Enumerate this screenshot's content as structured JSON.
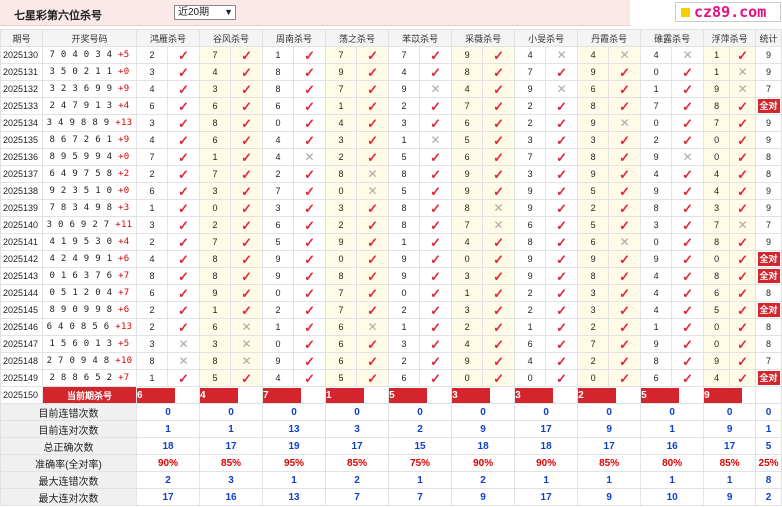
{
  "header": {
    "title": "七星彩第六位杀号",
    "select_value": "近20期"
  },
  "logo": {
    "text": "cz89.com"
  },
  "columns": [
    "期号",
    "开奖号码",
    "鸿雁杀号",
    "谷风杀号",
    "周南杀号",
    "荡之杀号",
    "苯苡杀号",
    "采薇杀号",
    "小旻杀号",
    "丹霞杀号",
    "碓露杀号",
    "浮萍杀号",
    "统计"
  ],
  "rows": [
    {
      "period": "2025130",
      "draw": "704034",
      "add": "+5",
      "kills": [
        [
          2,
          1
        ],
        [
          7,
          1
        ],
        [
          1,
          1
        ],
        [
          7,
          1
        ],
        [
          7,
          1
        ],
        [
          9,
          1
        ],
        [
          4,
          0
        ],
        [
          4,
          0
        ],
        [
          4,
          0
        ],
        [
          1,
          1
        ]
      ],
      "stat": "9"
    },
    {
      "period": "2025131",
      "draw": "350211",
      "add": "+0",
      "kills": [
        [
          3,
          1
        ],
        [
          4,
          1
        ],
        [
          8,
          1
        ],
        [
          9,
          1
        ],
        [
          4,
          1
        ],
        [
          8,
          1
        ],
        [
          7,
          1
        ],
        [
          9,
          1
        ],
        [
          0,
          1
        ],
        [
          1,
          0
        ]
      ],
      "stat": "9"
    },
    {
      "period": "2025132",
      "draw": "323699",
      "add": "+9",
      "kills": [
        [
          4,
          1
        ],
        [
          3,
          1
        ],
        [
          8,
          1
        ],
        [
          7,
          1
        ],
        [
          9,
          0
        ],
        [
          4,
          1
        ],
        [
          9,
          0
        ],
        [
          6,
          1
        ],
        [
          1,
          1
        ],
        [
          9,
          0
        ]
      ],
      "stat": "7"
    },
    {
      "period": "2025133",
      "draw": "247913",
      "add": "+4",
      "kills": [
        [
          6,
          1
        ],
        [
          6,
          1
        ],
        [
          6,
          1
        ],
        [
          1,
          1
        ],
        [
          2,
          1
        ],
        [
          7,
          1
        ],
        [
          2,
          1
        ],
        [
          8,
          1
        ],
        [
          7,
          1
        ],
        [
          8,
          1
        ]
      ],
      "stat": "all"
    },
    {
      "period": "2025134",
      "draw": "349889",
      "add": "+13",
      "kills": [
        [
          3,
          1
        ],
        [
          8,
          1
        ],
        [
          0,
          1
        ],
        [
          4,
          1
        ],
        [
          3,
          1
        ],
        [
          6,
          1
        ],
        [
          2,
          1
        ],
        [
          9,
          0
        ],
        [
          0,
          1
        ],
        [
          7,
          1
        ]
      ],
      "stat": "9"
    },
    {
      "period": "2025135",
      "draw": "867261",
      "add": "+9",
      "kills": [
        [
          4,
          1
        ],
        [
          6,
          1
        ],
        [
          4,
          1
        ],
        [
          3,
          1
        ],
        [
          1,
          0
        ],
        [
          5,
          1
        ],
        [
          3,
          1
        ],
        [
          3,
          1
        ],
        [
          2,
          1
        ],
        [
          0,
          1
        ]
      ],
      "stat": "9"
    },
    {
      "period": "2025136",
      "draw": "895994",
      "add": "+0",
      "kills": [
        [
          7,
          1
        ],
        [
          1,
          1
        ],
        [
          4,
          0
        ],
        [
          2,
          1
        ],
        [
          5,
          1
        ],
        [
          6,
          1
        ],
        [
          7,
          1
        ],
        [
          8,
          1
        ],
        [
          9,
          0
        ],
        [
          0,
          1
        ]
      ],
      "stat": "8"
    },
    {
      "period": "2025137",
      "draw": "649758",
      "add": "+2",
      "kills": [
        [
          2,
          1
        ],
        [
          7,
          1
        ],
        [
          2,
          1
        ],
        [
          8,
          0
        ],
        [
          8,
          1
        ],
        [
          9,
          1
        ],
        [
          3,
          1
        ],
        [
          9,
          1
        ],
        [
          4,
          1
        ],
        [
          4,
          1
        ]
      ],
      "stat": "8"
    },
    {
      "period": "2025138",
      "draw": "923510",
      "add": "+0",
      "kills": [
        [
          6,
          1
        ],
        [
          3,
          1
        ],
        [
          7,
          1
        ],
        [
          0,
          0
        ],
        [
          5,
          1
        ],
        [
          9,
          1
        ],
        [
          9,
          1
        ],
        [
          5,
          1
        ],
        [
          9,
          1
        ],
        [
          4,
          1
        ]
      ],
      "stat": "9"
    },
    {
      "period": "2025139",
      "draw": "783498",
      "add": "+3",
      "kills": [
        [
          1,
          1
        ],
        [
          0,
          1
        ],
        [
          3,
          1
        ],
        [
          3,
          1
        ],
        [
          8,
          1
        ],
        [
          8,
          0
        ],
        [
          9,
          1
        ],
        [
          2,
          1
        ],
        [
          8,
          1
        ],
        [
          3,
          1
        ]
      ],
      "stat": "9"
    },
    {
      "period": "2025140",
      "draw": "306927",
      "add": "+11",
      "kills": [
        [
          3,
          1
        ],
        [
          2,
          1
        ],
        [
          6,
          1
        ],
        [
          2,
          1
        ],
        [
          8,
          1
        ],
        [
          7,
          0
        ],
        [
          6,
          1
        ],
        [
          5,
          1
        ],
        [
          3,
          1
        ],
        [
          7,
          0
        ]
      ],
      "stat": "7"
    },
    {
      "period": "2025141",
      "draw": "419530",
      "add": "+4",
      "kills": [
        [
          2,
          1
        ],
        [
          7,
          1
        ],
        [
          5,
          1
        ],
        [
          9,
          1
        ],
        [
          1,
          1
        ],
        [
          4,
          1
        ],
        [
          8,
          1
        ],
        [
          6,
          0
        ],
        [
          0,
          1
        ],
        [
          8,
          1
        ]
      ],
      "stat": "9"
    },
    {
      "period": "2025142",
      "draw": "424991",
      "add": "+6",
      "kills": [
        [
          4,
          1
        ],
        [
          8,
          1
        ],
        [
          9,
          1
        ],
        [
          0,
          1
        ],
        [
          9,
          1
        ],
        [
          0,
          1
        ],
        [
          9,
          1
        ],
        [
          9,
          1
        ],
        [
          9,
          1
        ],
        [
          0,
          1
        ]
      ],
      "stat": "all"
    },
    {
      "period": "2025143",
      "draw": "016376",
      "add": "+7",
      "kills": [
        [
          8,
          1
        ],
        [
          8,
          1
        ],
        [
          9,
          1
        ],
        [
          8,
          1
        ],
        [
          9,
          1
        ],
        [
          3,
          1
        ],
        [
          9,
          1
        ],
        [
          8,
          1
        ],
        [
          4,
          1
        ],
        [
          8,
          1
        ]
      ],
      "stat": "all"
    },
    {
      "period": "2025144",
      "draw": "051204",
      "add": "+7",
      "kills": [
        [
          6,
          1
        ],
        [
          9,
          1
        ],
        [
          0,
          1
        ],
        [
          7,
          1
        ],
        [
          0,
          1
        ],
        [
          1,
          1
        ],
        [
          2,
          1
        ],
        [
          3,
          1
        ],
        [
          4,
          1
        ],
        [
          6,
          1
        ]
      ],
      "stat": "8"
    },
    {
      "period": "2025145",
      "draw": "890998",
      "add": "+6",
      "kills": [
        [
          2,
          1
        ],
        [
          1,
          1
        ],
        [
          2,
          1
        ],
        [
          7,
          1
        ],
        [
          2,
          1
        ],
        [
          3,
          1
        ],
        [
          2,
          1
        ],
        [
          3,
          1
        ],
        [
          4,
          1
        ],
        [
          5,
          1
        ]
      ],
      "stat": "all"
    },
    {
      "period": "2025146",
      "draw": "640856",
      "add": "+13",
      "kills": [
        [
          2,
          1
        ],
        [
          6,
          0
        ],
        [
          1,
          1
        ],
        [
          6,
          0
        ],
        [
          1,
          1
        ],
        [
          2,
          1
        ],
        [
          1,
          1
        ],
        [
          2,
          1
        ],
        [
          1,
          1
        ],
        [
          0,
          1
        ]
      ],
      "stat": "8"
    },
    {
      "period": "2025147",
      "draw": "156013",
      "add": "+5",
      "kills": [
        [
          3,
          0
        ],
        [
          3,
          0
        ],
        [
          0,
          1
        ],
        [
          6,
          1
        ],
        [
          3,
          1
        ],
        [
          4,
          1
        ],
        [
          6,
          1
        ],
        [
          7,
          1
        ],
        [
          9,
          1
        ],
        [
          0,
          1
        ]
      ],
      "stat": "8"
    },
    {
      "period": "2025148",
      "draw": "270948",
      "add": "+10",
      "kills": [
        [
          8,
          0
        ],
        [
          8,
          0
        ],
        [
          9,
          1
        ],
        [
          6,
          1
        ],
        [
          2,
          1
        ],
        [
          9,
          1
        ],
        [
          4,
          1
        ],
        [
          2,
          1
        ],
        [
          8,
          1
        ],
        [
          9,
          1
        ]
      ],
      "stat": "7"
    },
    {
      "period": "2025149",
      "draw": "288652",
      "add": "+7",
      "kills": [
        [
          1,
          1
        ],
        [
          5,
          1
        ],
        [
          4,
          1
        ],
        [
          5,
          1
        ],
        [
          6,
          1
        ],
        [
          0,
          1
        ],
        [
          0,
          1
        ],
        [
          0,
          1
        ],
        [
          6,
          1
        ],
        [
          4,
          1
        ]
      ],
      "stat": "all"
    }
  ],
  "current": {
    "period": "2025150",
    "label": "当前期杀号",
    "kills": [
      "6",
      "4",
      "7",
      "1",
      "5",
      "3",
      "3",
      "2",
      "5",
      "9"
    ]
  },
  "all_text": "全对",
  "stats": [
    {
      "name": "目前连错次数",
      "values": [
        "0",
        "0",
        "0",
        "0",
        "0",
        "0",
        "0",
        "0",
        "0",
        "0",
        "0"
      ],
      "red": false
    },
    {
      "name": "目前连对次数",
      "values": [
        "1",
        "1",
        "13",
        "3",
        "2",
        "9",
        "17",
        "9",
        "1",
        "9",
        "1"
      ],
      "red": false
    },
    {
      "name": "总正确次数",
      "values": [
        "18",
        "17",
        "19",
        "17",
        "15",
        "18",
        "18",
        "17",
        "16",
        "17",
        "5"
      ],
      "red": false
    },
    {
      "name": "准确率(全对率)",
      "values": [
        "90%",
        "85%",
        "95%",
        "85%",
        "75%",
        "90%",
        "90%",
        "85%",
        "80%",
        "85%",
        "25%"
      ],
      "red": true
    },
    {
      "name": "最大连错次数",
      "values": [
        "2",
        "3",
        "1",
        "2",
        "1",
        "2",
        "1",
        "1",
        "1",
        "1",
        "8"
      ],
      "red": false
    },
    {
      "name": "最大连对次数",
      "values": [
        "17",
        "16",
        "13",
        "7",
        "7",
        "9",
        "17",
        "9",
        "10",
        "9",
        "2"
      ],
      "red": false
    }
  ]
}
